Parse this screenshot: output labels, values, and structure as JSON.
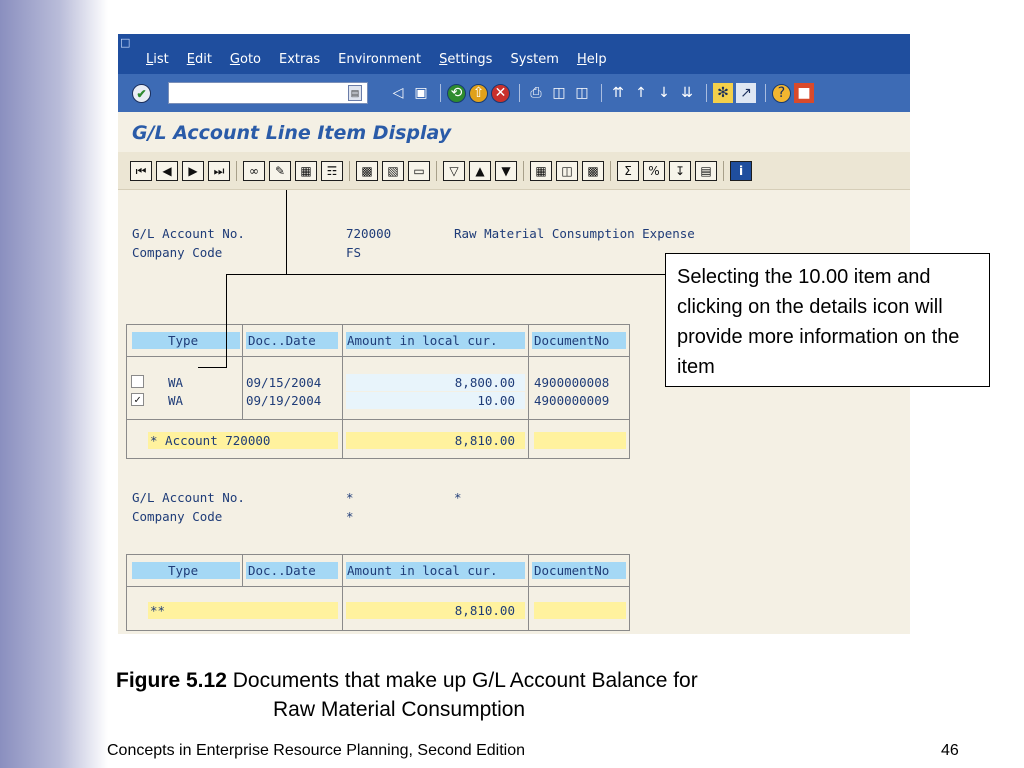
{
  "menu": {
    "items": [
      "List",
      "Edit",
      "Goto",
      "Extras",
      "Environment",
      "Settings",
      "System",
      "Help"
    ]
  },
  "system_toolbar": {
    "command_value": "",
    "icons": [
      "enter-icon",
      "back-arrow-icon",
      "save-icon",
      "back-icon",
      "exit-icon",
      "cancel-icon",
      "print-icon",
      "find-icon",
      "find-next-icon",
      "first-page-icon",
      "previous-page-icon",
      "next-page-icon",
      "last-page-icon",
      "create-session-icon",
      "shortcut-icon",
      "help-icon",
      "layout-menu-icon"
    ]
  },
  "screen": {
    "title": "G/L Account Line Item Display"
  },
  "app_toolbar": {
    "icons": [
      "first-icon",
      "previous-icon",
      "next-icon",
      "last-icon",
      "details-icon",
      "change-icon",
      "select-layout-icon",
      "display-document-icon",
      "choose-icon",
      "save-variant-icon",
      "current-icon",
      "filter-icon",
      "sort-ascending-icon",
      "sort-descending-icon",
      "grid-icon",
      "column-icon",
      "grid-options-icon",
      "sum-icon",
      "subtotal-icon",
      "export-icon",
      "print-preview-icon",
      "info-icon"
    ]
  },
  "report": {
    "section1": {
      "gl_label": "G/L Account No.",
      "gl_value": "720000",
      "gl_desc": "Raw Material Consumption Expense",
      "cc_label": "Company Code",
      "cc_value": "FS",
      "headers": [
        "Type",
        "Doc..Date",
        "Amount in local cur.",
        "DocumentNo"
      ],
      "rows": [
        {
          "checked": false,
          "type": "WA",
          "date": "09/15/2004",
          "amount": "8,800.00",
          "docno": "4900000008"
        },
        {
          "checked": true,
          "type": "WA",
          "date": "09/19/2004",
          "amount": "10.00",
          "docno": "4900000009"
        }
      ],
      "total_label": "* Account 720000",
      "total_amount": "8,810.00"
    },
    "section2": {
      "gl_label": "G/L Account No.",
      "gl_value": "*",
      "gl_desc": "*",
      "cc_label": "Company Code",
      "cc_value": "*",
      "headers": [
        "Type",
        "Doc..Date",
        "Amount in local cur.",
        "DocumentNo"
      ],
      "total_label": "**",
      "total_amount": "8,810.00"
    }
  },
  "callout": {
    "text": "Selecting the 10.00 item and clicking on the details icon will provide more information on the item"
  },
  "caption": {
    "label": "Figure 5.12",
    "line1": "Documents that make up G/L Account Balance for",
    "line2": "Raw Material Consumption"
  },
  "footer": {
    "left": "Concepts in Enterprise Resource Planning, Second Edition",
    "page": "46"
  }
}
